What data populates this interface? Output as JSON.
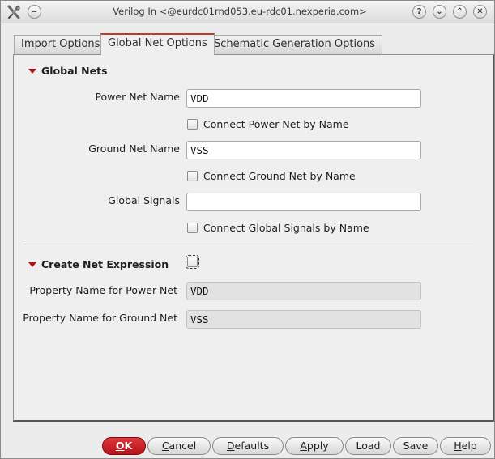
{
  "window": {
    "title": "Verilog In <@eurdc01rnd053.eu-rdc01.nexperia.com>",
    "controls": {
      "help": "?",
      "minimize": "⌄",
      "maximize": "⌃",
      "close": "✕"
    }
  },
  "tabs": [
    {
      "label": "Import Options",
      "active": false
    },
    {
      "label": "Global Net Options",
      "active": true
    },
    {
      "label": "Schematic Generation Options",
      "active": false
    }
  ],
  "global_nets": {
    "heading": "Global Nets",
    "power_net_label": "Power Net Name",
    "power_net_value": "VDD",
    "connect_power_label": "Connect Power Net by Name",
    "connect_power_checked": false,
    "ground_net_label": "Ground Net Name",
    "ground_net_value": "VSS",
    "connect_ground_label": "Connect Ground Net by Name",
    "connect_ground_checked": false,
    "global_signals_label": "Global Signals",
    "global_signals_value": "",
    "connect_global_label": "Connect Global Signals by Name",
    "connect_global_checked": false
  },
  "net_expression": {
    "heading": "Create Net Expression",
    "enabled": false,
    "power_prop_label": "Property Name for Power Net",
    "power_prop_value": "VDD",
    "ground_prop_label": "Property Name for Ground Net",
    "ground_prop_value": "VSS"
  },
  "buttons": {
    "ok_mnemonic": "O",
    "ok_rest": "K",
    "cancel_mnemonic": "C",
    "cancel_rest": "ancel",
    "defaults_mnemonic": "D",
    "defaults_rest": "efaults",
    "apply_mnemonic": "A",
    "apply_rest": "pply",
    "load": "Load",
    "save": "Save",
    "help_mnemonic": "H",
    "help_rest": "elp"
  },
  "colors": {
    "accent": "#c0392b",
    "ok_button": "#c8191f"
  },
  "icons": {
    "app": "app-tool-icon",
    "window_menu": "window-menu-icon"
  }
}
